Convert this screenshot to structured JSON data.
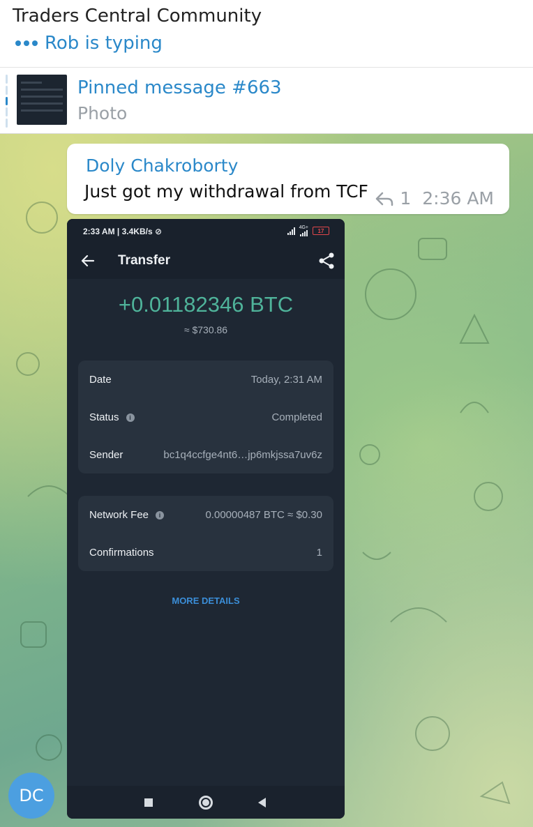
{
  "header": {
    "title": "Traders Central Community",
    "typing_status": "Rob is typing"
  },
  "pinned": {
    "title": "Pinned message #663",
    "subtitle": "Photo"
  },
  "message": {
    "sender": "Doly Chakroborty",
    "text": "Just got my withdrawal from TCF",
    "reply_count": "1",
    "time": "2:36 AM"
  },
  "photo": {
    "status_bar": {
      "time": "2:33 AM | 3.4KB/s",
      "network": "4G+",
      "battery": "17"
    },
    "app_title": "Transfer",
    "amount": "+0.01182346 BTC",
    "amount_usd": "≈ $730.86",
    "details": [
      {
        "label": "Date",
        "value": "Today, 2:31 AM"
      },
      {
        "label": "Status",
        "value": "Completed"
      },
      {
        "label": "Sender",
        "value": "bc1q4ccfge4nt6…jp6mkjssa7uv6z"
      }
    ],
    "fees": [
      {
        "label": "Network Fee",
        "value": "0.00000487 BTC ≈ $0.30"
      },
      {
        "label": "Confirmations",
        "value": "1"
      }
    ],
    "more_details": "MORE DETAILS"
  },
  "avatar": {
    "initials": "DC"
  },
  "colors": {
    "accent": "#2a88c9",
    "amount_green": "#4fb39a",
    "avatar_blue": "#4c9fe0"
  }
}
